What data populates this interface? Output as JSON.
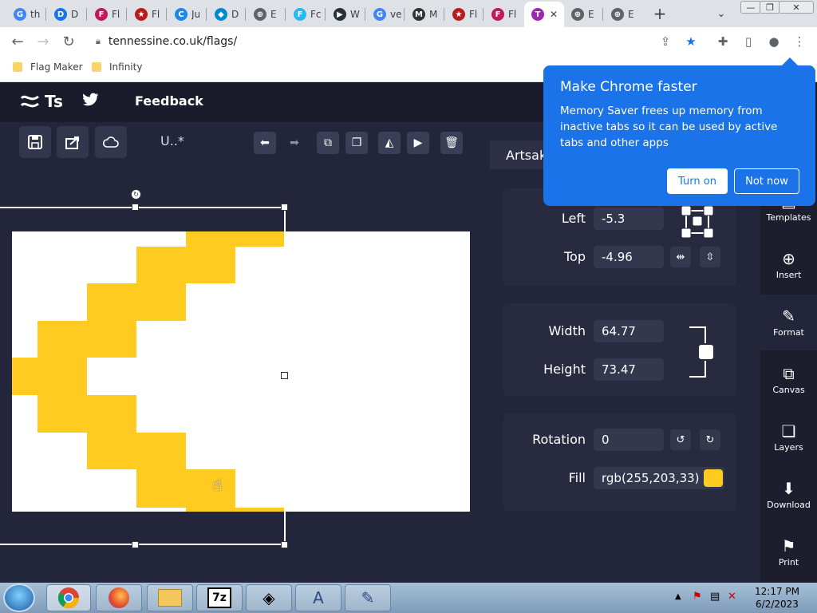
{
  "browser": {
    "tabs": [
      {
        "label": "th",
        "icon": "google-icon",
        "color": "#4285f4",
        "letter": "G"
      },
      {
        "label": "D",
        "icon": "people-icon",
        "color": "#1a73e8",
        "letter": "D"
      },
      {
        "label": "Fl",
        "icon": "flag-heart-icon",
        "color": "#c2185b",
        "letter": "F"
      },
      {
        "label": "Fl",
        "icon": "flag-star-icon",
        "color": "#b71c1c",
        "letter": "★"
      },
      {
        "label": "Ju",
        "icon": "jupyter-icon",
        "color": "#1e88e5",
        "letter": "C"
      },
      {
        "label": "D",
        "icon": "diamond-icon",
        "color": "#0288d1",
        "letter": "◆"
      },
      {
        "label": "E",
        "icon": "globe-icon",
        "color": "#5f6368",
        "letter": "⊕"
      },
      {
        "label": "Fc",
        "icon": "fc-icon",
        "color": "#29b6f6",
        "letter": "F"
      },
      {
        "label": "W",
        "icon": "w-icon",
        "color": "#263238",
        "letter": "▶"
      },
      {
        "label": "ve",
        "icon": "google-icon",
        "color": "#4285f4",
        "letter": "G"
      },
      {
        "label": "M",
        "icon": "m-icon",
        "color": "#333333",
        "letter": "M"
      },
      {
        "label": "Fl",
        "icon": "flag-star-icon",
        "color": "#b71c1c",
        "letter": "★"
      },
      {
        "label": "Fl",
        "icon": "flag-heart-icon",
        "color": "#c2185b",
        "letter": "F"
      },
      {
        "label": "",
        "icon": "tennessine-icon",
        "color": "#9c27b0",
        "letter": "T"
      },
      {
        "label": "E",
        "icon": "globe-icon",
        "color": "#5f6368",
        "letter": "⊕"
      },
      {
        "label": "E",
        "icon": "globe-icon",
        "color": "#5f6368",
        "letter": "⊕"
      }
    ],
    "url": "tennessine.co.uk/flags/",
    "bookmarks": [
      "Flag Maker",
      "Infinity"
    ]
  },
  "app": {
    "logo": "Ts",
    "feedback": "Feedback",
    "doc_name": "U..*",
    "layer_tab": "Artsak"
  },
  "popup": {
    "title": "Make Chrome faster",
    "body": "Memory Saver frees up memory from inactive tabs so it can be used by active tabs and other apps",
    "turn_on": "Turn on",
    "not_now": "Not now"
  },
  "props": {
    "left_label": "Left",
    "left": "-5.3",
    "top_label": "Top",
    "top": "-4.96",
    "width_label": "Width",
    "width": "64.77",
    "height_label": "Height",
    "height": "73.47",
    "rotation_label": "Rotation",
    "rotation": "0",
    "fill_label": "Fill",
    "fill": "rgb(255,203,33)",
    "fill_color": "#ffcb21"
  },
  "rightbar": [
    {
      "label": "Templates",
      "icon": "templates-icon"
    },
    {
      "label": "Insert",
      "icon": "insert-icon"
    },
    {
      "label": "Format",
      "icon": "format-icon"
    },
    {
      "label": "Canvas",
      "icon": "canvas-icon"
    },
    {
      "label": "Layers",
      "icon": "layers-icon"
    },
    {
      "label": "Download",
      "icon": "download-icon"
    },
    {
      "label": "Print",
      "icon": "print-icon"
    }
  ],
  "taskbar": {
    "time": "12:17 PM",
    "date": "6/2/2023"
  }
}
